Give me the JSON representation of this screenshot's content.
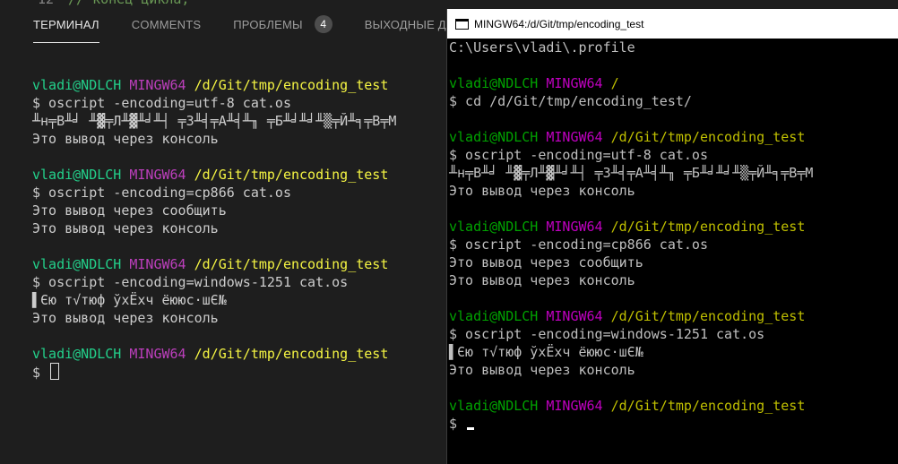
{
  "editor_peek": {
    "line_number": "12",
    "code": "// конец цикла;"
  },
  "vscode_panel": {
    "tabs": [
      {
        "label": "ТЕРМИНАЛ",
        "active": true
      },
      {
        "label": "COMMENTS",
        "active": false
      },
      {
        "label": "ПРОБЛЕМЫ",
        "active": false,
        "badge": "4"
      },
      {
        "label": "ВЫХОДНЫЕ ДАННЫЕ",
        "active": false
      }
    ]
  },
  "left_terminal": {
    "prompt": {
      "user": "vladi@NDLCH",
      "system": "MINGW64",
      "cwd": "/d/Git/tmp/encoding_test"
    },
    "blocks": [
      {
        "command": "$ oscript -encoding=utf-8 cat.os",
        "output": [
          "╨н╤В╨╛ ╨▓╤Л╨▓╨╛╨┤ ╤З╨╡╤А╨╡╨╖ ╤Б╨╛╨╛╨▒╤Й╨╕╤В╤М",
          "Это вывод через консоль"
        ]
      },
      {
        "command": "$ oscript -encoding=cp866 cat.os",
        "output": [
          "Это вывод через сообщить",
          "Это вывод через консоль"
        ]
      },
      {
        "command": "$ oscript -encoding=windows-1251 cat.os",
        "output": [
          "▌Єю т√тюф ўхЁхч ёююс·шЄ№",
          "Это вывод через консоль"
        ]
      }
    ],
    "final_prompt": "$ "
  },
  "mintty": {
    "title": "MINGW64:/d/Git/tmp/encoding_test",
    "first_line": "C:\\Users\\vladi\\.profile",
    "prompt": {
      "user": "vladi@NDLCH",
      "system": "MINGW64",
      "home_cwd": "/",
      "cwd": "/d/Git/tmp/encoding_test"
    },
    "cd_command": "$ cd /d/Git/tmp/encoding_test/",
    "blocks": [
      {
        "command": "$ oscript -encoding=utf-8 cat.os",
        "output": [
          "╨н╤В╨╛ ╨▓╤Л╨▓╨╛╨┤ ╤З╨╡╤А╨╡╨╖ ╤Б╨╛╨╛╨▒╤Й╨╕╤В╤М",
          "Это вывод через консоль"
        ]
      },
      {
        "command": "$ oscript -encoding=cp866 cat.os",
        "output": [
          "Это вывод через сообщить",
          "Это вывод через консоль"
        ]
      },
      {
        "command": "$ oscript -encoding=windows-1251 cat.os",
        "output": [
          "▌Єю т√тюф ўхЁхч ёююс·шЄ№",
          "Это вывод через консоль"
        ]
      }
    ],
    "final_prompt": "$ "
  },
  "colors": {
    "left_user": "#23d18b",
    "left_system": "#bc3fbc",
    "left_path": "#f5f543",
    "right_user": "#00a300",
    "right_system": "#bf00bf",
    "right_path": "#bfbf00"
  }
}
